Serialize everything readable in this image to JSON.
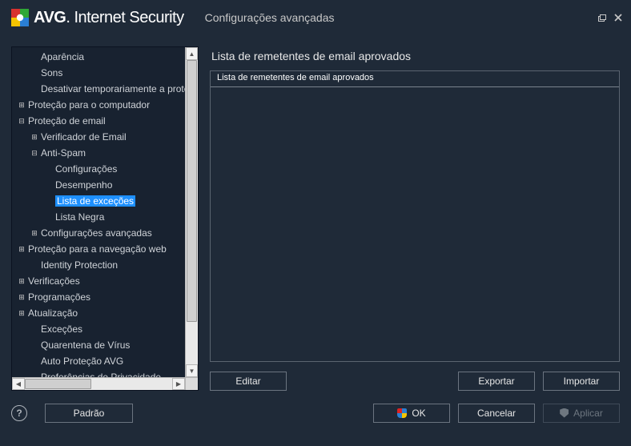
{
  "titlebar": {
    "brand_bold": "AVG",
    "brand_light": ". Internet Security",
    "subtitle": "Configurações avançadas"
  },
  "tree": {
    "items": [
      {
        "level": 1,
        "expander": "",
        "label": "Aparência"
      },
      {
        "level": 1,
        "expander": "",
        "label": "Sons"
      },
      {
        "level": 1,
        "expander": "",
        "label": "Desativar temporariamente a proteção do AVG"
      },
      {
        "level": 0,
        "expander": "+",
        "label": "Proteção para o computador"
      },
      {
        "level": 0,
        "expander": "−",
        "label": "Proteção de email"
      },
      {
        "level": 1,
        "expander": "+",
        "label": "Verificador de Email"
      },
      {
        "level": 1,
        "expander": "−",
        "label": "Anti-Spam"
      },
      {
        "level": 2,
        "expander": "",
        "label": "Configurações"
      },
      {
        "level": 2,
        "expander": "",
        "label": "Desempenho"
      },
      {
        "level": 2,
        "expander": "",
        "label": "Lista de exceções",
        "selected": true
      },
      {
        "level": 2,
        "expander": "",
        "label": "Lista Negra"
      },
      {
        "level": 1,
        "expander": "+",
        "label": "Configurações avançadas"
      },
      {
        "level": 0,
        "expander": "+",
        "label": "Proteção para a navegação web"
      },
      {
        "level": 1,
        "expander": "",
        "label": "Identity Protection"
      },
      {
        "level": 0,
        "expander": "+",
        "label": "Verificações"
      },
      {
        "level": 0,
        "expander": "+",
        "label": "Programações"
      },
      {
        "level": 0,
        "expander": "+",
        "label": "Atualização"
      },
      {
        "level": 1,
        "expander": "",
        "label": "Exceções"
      },
      {
        "level": 1,
        "expander": "",
        "label": "Quarentena de Vírus"
      },
      {
        "level": 1,
        "expander": "",
        "label": "Auto Proteção AVG"
      },
      {
        "level": 1,
        "expander": "",
        "label": "Preferências de Privacidade"
      }
    ]
  },
  "content": {
    "title": "Lista de remetentes de email aprovados",
    "list_header": "Lista de remetentes de email aprovados",
    "buttons": {
      "edit": "Editar",
      "export": "Exportar",
      "import": "Importar"
    }
  },
  "footer": {
    "help": "?",
    "default": "Padrão",
    "ok": "OK",
    "cancel": "Cancelar",
    "apply": "Aplicar"
  }
}
